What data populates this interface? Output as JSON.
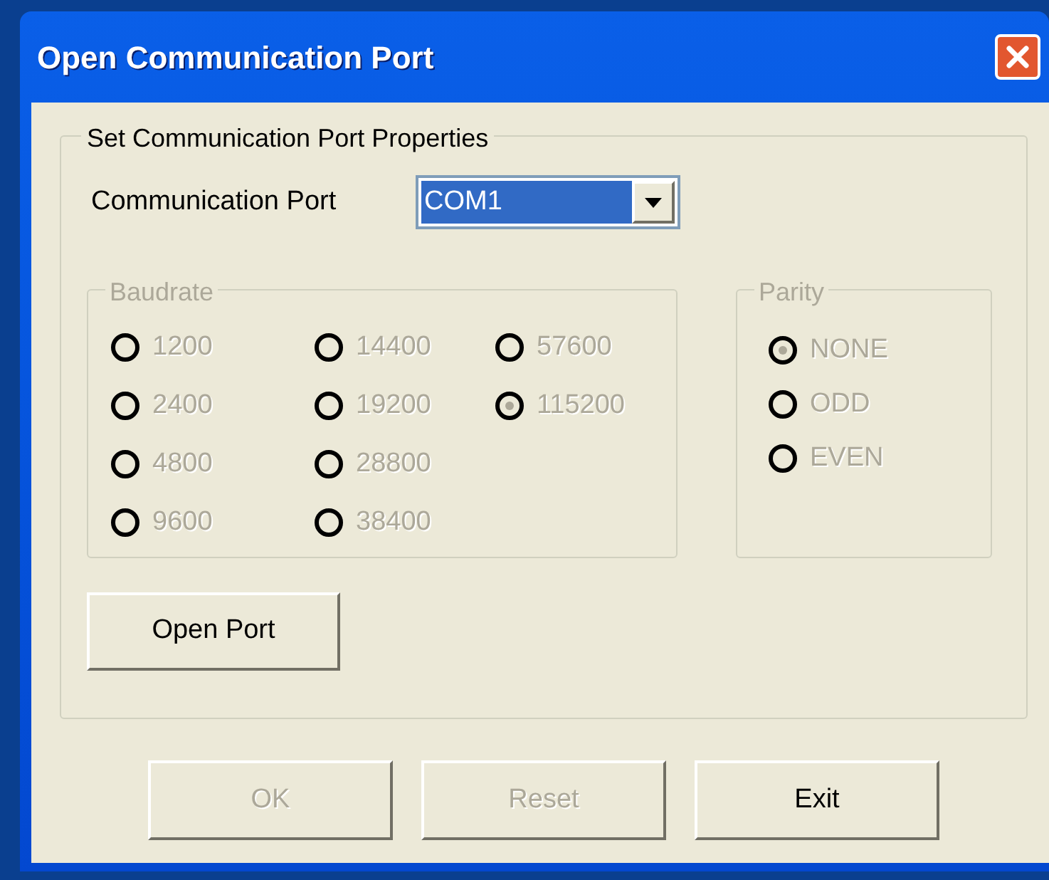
{
  "window": {
    "title": "Open Communication Port"
  },
  "group": {
    "title": "Set Communication Port Properties",
    "port": {
      "label": "Communication Port",
      "value": "COM1",
      "focused": true
    },
    "baudrate": {
      "title": "Baudrate",
      "disabled": true,
      "options": [
        {
          "label": "1200",
          "selected": false
        },
        {
          "label": "2400",
          "selected": false
        },
        {
          "label": "4800",
          "selected": false
        },
        {
          "label": "9600",
          "selected": false
        },
        {
          "label": "14400",
          "selected": false
        },
        {
          "label": "19200",
          "selected": false
        },
        {
          "label": "28800",
          "selected": false
        },
        {
          "label": "38400",
          "selected": false
        },
        {
          "label": "57600",
          "selected": false
        },
        {
          "label": "115200",
          "selected": true
        }
      ]
    },
    "parity": {
      "title": "Parity",
      "disabled": true,
      "options": [
        {
          "label": "NONE",
          "selected": true
        },
        {
          "label": "ODD",
          "selected": false
        },
        {
          "label": "EVEN",
          "selected": false
        }
      ]
    },
    "open_button": {
      "label": "Open Port",
      "disabled": false
    }
  },
  "buttons": [
    {
      "label": "OK",
      "disabled": true
    },
    {
      "label": "Reset",
      "disabled": true
    },
    {
      "label": "Exit",
      "disabled": false
    }
  ]
}
